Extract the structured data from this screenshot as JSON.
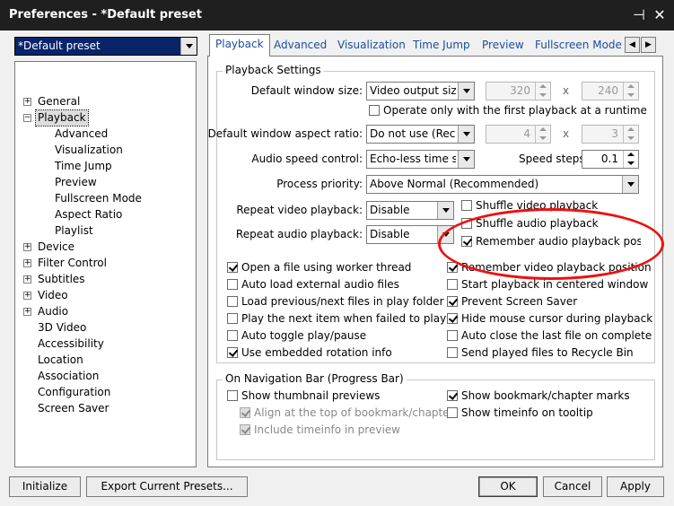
{
  "window": {
    "title": "Preferences - *Default preset",
    "pin_glyph": "⊣",
    "close_glyph": "✕"
  },
  "preset": {
    "value": "*Default preset"
  },
  "tree": {
    "nodes": [
      {
        "label": "General",
        "expander": "+"
      },
      {
        "label": "Playback",
        "expander": "−"
      },
      {
        "label": "Device",
        "expander": "+"
      },
      {
        "label": "Filter Control",
        "expander": "+"
      },
      {
        "label": "Subtitles",
        "expander": "+"
      },
      {
        "label": "Video",
        "expander": "+"
      },
      {
        "label": "Audio",
        "expander": "+"
      },
      {
        "label": "3D Video"
      },
      {
        "label": "Accessibility"
      },
      {
        "label": "Location"
      },
      {
        "label": "Association"
      },
      {
        "label": "Configuration"
      },
      {
        "label": "Screen Saver"
      }
    ],
    "playback_children": [
      "Advanced",
      "Visualization",
      "Time Jump",
      "Preview",
      "Fullscreen Mode",
      "Aspect Ratio",
      "Playlist"
    ]
  },
  "tabs": [
    "Playback",
    "Advanced",
    "Visualization",
    "Time Jump",
    "Preview",
    "Fullscreen Mode"
  ],
  "tab_scroll": {
    "left": "◀",
    "right": "▶"
  },
  "playback_settings": {
    "title": "Playback Settings",
    "window_size_label": "Default window size:",
    "window_size_value": "Video output size",
    "width_value": "320",
    "height_value": "240",
    "times": "x",
    "first_playback_only": "Operate only with the first playback at a runtime",
    "aspect_label": "Default window aspect ratio:",
    "aspect_value": "Do not use (Recom",
    "aspect_w": "4",
    "aspect_h": "3",
    "audio_speed_label": "Audio speed control:",
    "audio_speed_value": "Echo-less time stre",
    "speed_steps_label": "Speed steps:",
    "speed_steps_value": "0.1",
    "priority_label": "Process priority:",
    "priority_value": "Above Normal (Recommended)",
    "repeat_video_label": "Repeat video playback:",
    "repeat_video_value": "Disable",
    "repeat_audio_label": "Repeat audio playback:",
    "repeat_audio_value": "Disable",
    "shuffle_video": "Shuffle video playback",
    "shuffle_audio": "Shuffle audio playback",
    "remember_audio": "Remember audio playback position",
    "left_checks": [
      "Open a file using worker thread",
      "Auto load external audio files",
      "Load previous/next files in play folder",
      "Play the next item when failed to play",
      "Auto toggle play/pause",
      "Use embedded rotation info"
    ],
    "right_checks": [
      "Remember video playback position",
      "Start playback in centered window",
      "Prevent Screen Saver",
      "Hide mouse cursor during playback",
      "Auto close the last file on complete",
      "Send played files to Recycle Bin"
    ]
  },
  "nav_bar": {
    "title": "On Navigation Bar (Progress Bar)",
    "thumbnail": "Show thumbnail previews",
    "align_top": "Align at the top of bookmark/chapter",
    "include_timeinfo": "Include timeinfo in preview",
    "bookmark_marks": "Show bookmark/chapter marks",
    "timeinfo_tooltip": "Show timeinfo on tooltip"
  },
  "buttons": {
    "initialize": "Initialize",
    "export": "Export Current Presets...",
    "ok": "OK",
    "cancel": "Cancel",
    "apply": "Apply"
  },
  "colors": {
    "annotation": "#ee1111",
    "tab_text": "#1a4fa0",
    "preset_bg": "#0a246a"
  }
}
